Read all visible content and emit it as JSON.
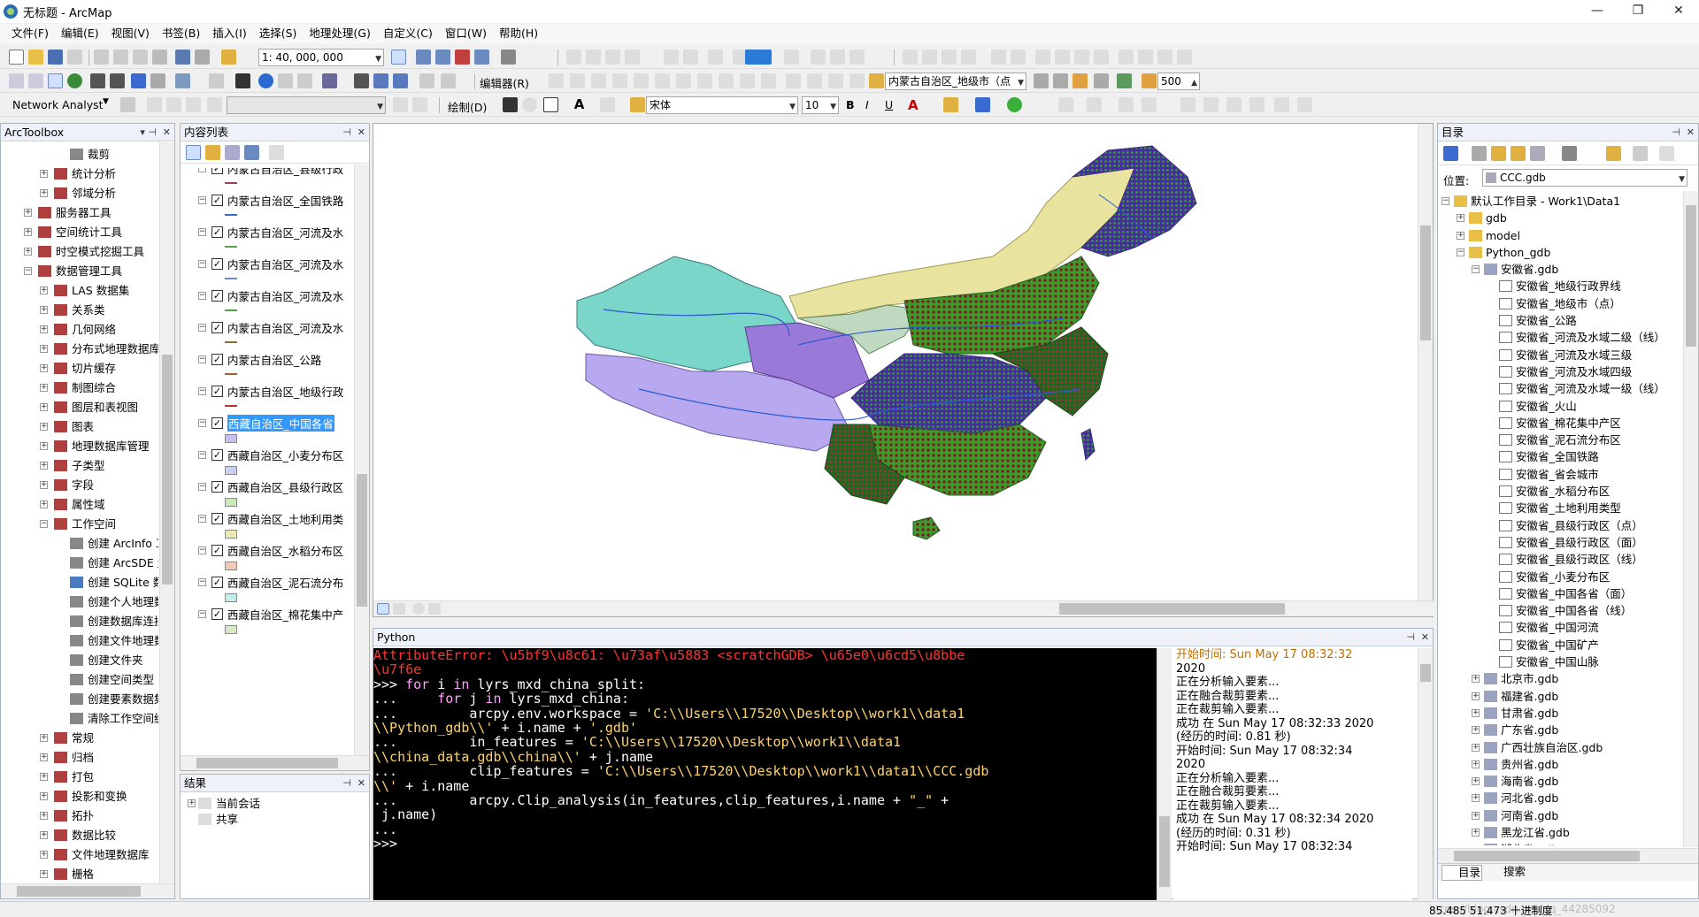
{
  "window": {
    "title": "无标题 - ArcMap",
    "btn_min": "—",
    "btn_max": "❐",
    "btn_close": "✕"
  },
  "menu": [
    "文件(F)",
    "编辑(E)",
    "视图(V)",
    "书签(B)",
    "插入(I)",
    "选择(S)",
    "地理处理(G)",
    "自定义(C)",
    "窗口(W)",
    "帮助(H)"
  ],
  "toolbar": {
    "scale": "1: 40, 000, 000",
    "editor_label": "编辑器(R)",
    "layer_combo": "内蒙古自治区_地级市（点",
    "distance": "500",
    "network_analyst": "Network Analyst",
    "draw_label": "绘制(D)",
    "font": "宋体",
    "font_size": "10",
    "bold": "B",
    "italic": "I",
    "underline": "U",
    "font_color": "A"
  },
  "arctoolbox": {
    "title": "ArcToolbox",
    "items": [
      {
        "label": "裁剪",
        "level": 2,
        "kind": "tool"
      },
      {
        "label": "统计分析",
        "level": 1,
        "kind": "box",
        "exp": "+"
      },
      {
        "label": "邻域分析",
        "level": 1,
        "kind": "box",
        "exp": "+"
      },
      {
        "label": "服务器工具",
        "level": 0,
        "kind": "box",
        "exp": "+"
      },
      {
        "label": "空间统计工具",
        "level": 0,
        "kind": "box",
        "exp": "+"
      },
      {
        "label": "时空模式挖掘工具",
        "level": 0,
        "kind": "box",
        "exp": "+"
      },
      {
        "label": "数据管理工具",
        "level": 0,
        "kind": "box",
        "exp": "−"
      },
      {
        "label": "LAS 数据集",
        "level": 1,
        "kind": "box",
        "exp": "+"
      },
      {
        "label": "关系类",
        "level": 1,
        "kind": "box",
        "exp": "+"
      },
      {
        "label": "几何网络",
        "level": 1,
        "kind": "box",
        "exp": "+"
      },
      {
        "label": "分布式地理数据库",
        "level": 1,
        "kind": "box",
        "exp": "+"
      },
      {
        "label": "切片缓存",
        "level": 1,
        "kind": "box",
        "exp": "+"
      },
      {
        "label": "制图综合",
        "level": 1,
        "kind": "box",
        "exp": "+"
      },
      {
        "label": "图层和表视图",
        "level": 1,
        "kind": "box",
        "exp": "+"
      },
      {
        "label": "图表",
        "level": 1,
        "kind": "box",
        "exp": "+"
      },
      {
        "label": "地理数据库管理",
        "level": 1,
        "kind": "box",
        "exp": "+"
      },
      {
        "label": "子类型",
        "level": 1,
        "kind": "box",
        "exp": "+"
      },
      {
        "label": "字段",
        "level": 1,
        "kind": "box",
        "exp": "+"
      },
      {
        "label": "属性域",
        "level": 1,
        "kind": "box",
        "exp": "+"
      },
      {
        "label": "工作空间",
        "level": 1,
        "kind": "box",
        "exp": "−"
      },
      {
        "label": "创建 ArcInfo 工",
        "level": 2,
        "kind": "tool"
      },
      {
        "label": "创建 ArcSDE 连",
        "level": 2,
        "kind": "tool"
      },
      {
        "label": "创建 SQLite 数据",
        "level": 2,
        "kind": "script"
      },
      {
        "label": "创建个人地理数据",
        "level": 2,
        "kind": "tool"
      },
      {
        "label": "创建数据库连接",
        "level": 2,
        "kind": "tool"
      },
      {
        "label": "创建文件地理数据",
        "level": 2,
        "kind": "tool"
      },
      {
        "label": "创建文件夹",
        "level": 2,
        "kind": "tool"
      },
      {
        "label": "创建空间类型",
        "level": 2,
        "kind": "tool"
      },
      {
        "label": "创建要素数据集",
        "level": 2,
        "kind": "tool"
      },
      {
        "label": "清除工作空间缓存",
        "level": 2,
        "kind": "tool"
      },
      {
        "label": "常规",
        "level": 1,
        "kind": "box",
        "exp": "+"
      },
      {
        "label": "归档",
        "level": 1,
        "kind": "box",
        "exp": "+"
      },
      {
        "label": "打包",
        "level": 1,
        "kind": "box",
        "exp": "+"
      },
      {
        "label": "投影和变换",
        "level": 1,
        "kind": "box",
        "exp": "+"
      },
      {
        "label": "拓扑",
        "level": 1,
        "kind": "box",
        "exp": "+"
      },
      {
        "label": "数据比较",
        "level": 1,
        "kind": "box",
        "exp": "+"
      },
      {
        "label": "文件地理数据库",
        "level": 1,
        "kind": "box",
        "exp": "+"
      },
      {
        "label": "栅格",
        "level": 1,
        "kind": "box",
        "exp": "+"
      }
    ]
  },
  "toc": {
    "title": "内容列表",
    "layers": [
      {
        "name": "内蒙古自治区_县级行政",
        "sym": "line",
        "color": "#a0405a"
      },
      {
        "name": "内蒙古自治区_全国铁路",
        "sym": "line",
        "color": "#3a6ad0"
      },
      {
        "name": "内蒙古自治区_河流及水",
        "sym": "line",
        "color": "#5aa050"
      },
      {
        "name": "内蒙古自治区_河流及水",
        "sym": "line",
        "color": "#6a8ac0"
      },
      {
        "name": "内蒙古自治区_河流及水",
        "sym": "line",
        "color": "#50a040"
      },
      {
        "name": "内蒙古自治区_河流及水",
        "sym": "line",
        "color": "#8a6a40"
      },
      {
        "name": "内蒙古自治区_公路",
        "sym": "line",
        "color": "#a06030"
      },
      {
        "name": "内蒙古自治区_地级行政",
        "sym": "line",
        "color": "#c03030"
      },
      {
        "name": "西藏自治区_中国各省",
        "sym": "fill",
        "color": "#c8c0ee",
        "selected": true
      },
      {
        "name": "西藏自治区_小麦分布区",
        "sym": "fill",
        "color": "#c8d0ee"
      },
      {
        "name": "西藏自治区_县级行政区",
        "sym": "fill",
        "color": "#cde8b8"
      },
      {
        "name": "西藏自治区_土地利用类",
        "sym": "fill",
        "color": "#ece8b4"
      },
      {
        "name": "西藏自治区_水稻分布区",
        "sym": "fill",
        "color": "#f0ccb8"
      },
      {
        "name": "西藏自治区_泥石流分布",
        "sym": "fill",
        "color": "#c4ecec"
      },
      {
        "name": "西藏自治区_棉花集中产",
        "sym": "fill",
        "color": "#d8e8c8"
      }
    ]
  },
  "results": {
    "title": "结果",
    "current": "当前会话",
    "shared": "共享"
  },
  "python": {
    "title": "Python",
    "lines": [
      [
        [
          "err",
          "AttributeError: \\u5bf9\\u8c61: \\u73af\\u5883 <scratchGDB> \\u65e0\\u6cd5\\u8bbe"
        ]
      ],
      [
        [
          "err",
          "\\u7f6e"
        ]
      ],
      [
        [
          "txt",
          ">>> "
        ],
        [
          "kw",
          "for"
        ],
        [
          "txt",
          " i "
        ],
        [
          "kw",
          "in"
        ],
        [
          "txt",
          " lyrs_mxd_china_split:"
        ]
      ],
      [
        [
          "txt",
          "...     "
        ],
        [
          "kw",
          "for"
        ],
        [
          "txt",
          " j "
        ],
        [
          "kw",
          "in"
        ],
        [
          "txt",
          " lyrs_mxd_china:"
        ]
      ],
      [
        [
          "txt",
          "...         arcpy.env.workspace = "
        ],
        [
          "str",
          "'C:\\\\Users\\\\17520\\\\Desktop\\\\work1\\\\data1"
        ]
      ],
      [
        [
          "str",
          "\\\\Python_gdb\\\\'"
        ],
        [
          "txt",
          " + i.name + "
        ],
        [
          "str",
          "'.gdb'"
        ]
      ],
      [
        [
          "txt",
          "...         in_features = "
        ],
        [
          "str",
          "'C:\\\\Users\\\\17520\\\\Desktop\\\\work1\\\\data1"
        ]
      ],
      [
        [
          "str",
          "\\\\china_data.gdb\\\\china\\\\'"
        ],
        [
          "txt",
          " + j.name"
        ]
      ],
      [
        [
          "txt",
          "...         clip_features = "
        ],
        [
          "str",
          "'C:\\\\Users\\\\17520\\\\Desktop\\\\work1\\\\data1\\\\CCC.gdb"
        ]
      ],
      [
        [
          "str",
          "\\\\'"
        ],
        [
          "txt",
          " + i.name"
        ]
      ],
      [
        [
          "txt",
          "...         arcpy.Clip_analysis(in_features,clip_features,i.name + "
        ],
        [
          "str",
          "\"_\""
        ],
        [
          "txt",
          " +"
        ]
      ],
      [
        [
          "txt",
          " j.name)"
        ]
      ],
      [
        [
          "txt",
          "..."
        ]
      ],
      [
        [
          "txt",
          ">>> "
        ]
      ]
    ],
    "output": [
      [
        "hl",
        "开始时间: Sun May 17 08:32:32"
      ],
      [
        "t",
        "2020"
      ],
      [
        "t",
        "正在分析输入要素..."
      ],
      [
        "t",
        "正在融合裁剪要素..."
      ],
      [
        "t",
        "正在裁剪输入要素..."
      ],
      [
        "t",
        "成功 在 Sun May 17 08:32:33 2020"
      ],
      [
        "t",
        "(经历的时间: 0.81 秒)"
      ],
      [
        "t",
        "开始时间: Sun May 17 08:32:34"
      ],
      [
        "t",
        "2020"
      ],
      [
        "t",
        "正在分析输入要素..."
      ],
      [
        "t",
        "正在融合裁剪要素..."
      ],
      [
        "t",
        "正在裁剪输入要素..."
      ],
      [
        "t",
        "成功 在 Sun May 17 08:32:34 2020"
      ],
      [
        "t",
        "(经历的时间: 0.31 秒)"
      ],
      [
        "t",
        "开始时间: Sun May 17 08:32:34"
      ]
    ]
  },
  "catalog": {
    "title": "目录",
    "location_label": "位置:",
    "location_value": "CCC.gdb",
    "items": [
      {
        "label": "默认工作目录 - Work1\\Data1",
        "level": 0,
        "kind": "folder",
        "exp": "−"
      },
      {
        "label": "gdb",
        "level": 1,
        "kind": "folder",
        "exp": "+"
      },
      {
        "label": "model",
        "level": 1,
        "kind": "folder",
        "exp": "+"
      },
      {
        "label": "Python_gdb",
        "level": 1,
        "kind": "folder",
        "exp": "−"
      },
      {
        "label": "安徽省.gdb",
        "level": 2,
        "kind": "gdb",
        "exp": "−"
      },
      {
        "label": "安徽省_地级行政界线",
        "level": 3,
        "kind": "fc"
      },
      {
        "label": "安徽省_地级市（点）",
        "level": 3,
        "kind": "fc"
      },
      {
        "label": "安徽省_公路",
        "level": 3,
        "kind": "fc"
      },
      {
        "label": "安徽省_河流及水域二级（线）",
        "level": 3,
        "kind": "fc"
      },
      {
        "label": "安徽省_河流及水域三级",
        "level": 3,
        "kind": "fc"
      },
      {
        "label": "安徽省_河流及水域四级",
        "level": 3,
        "kind": "fc"
      },
      {
        "label": "安徽省_河流及水域一级（线）",
        "level": 3,
        "kind": "fc"
      },
      {
        "label": "安徽省_火山",
        "level": 3,
        "kind": "fc"
      },
      {
        "label": "安徽省_棉花集中产区",
        "level": 3,
        "kind": "fc"
      },
      {
        "label": "安徽省_泥石流分布区",
        "level": 3,
        "kind": "fc"
      },
      {
        "label": "安徽省_全国铁路",
        "level": 3,
        "kind": "fc"
      },
      {
        "label": "安徽省_省会城市",
        "level": 3,
        "kind": "fc"
      },
      {
        "label": "安徽省_水稻分布区",
        "level": 3,
        "kind": "fc"
      },
      {
        "label": "安徽省_土地利用类型",
        "level": 3,
        "kind": "fc"
      },
      {
        "label": "安徽省_县级行政区（点）",
        "level": 3,
        "kind": "fc"
      },
      {
        "label": "安徽省_县级行政区（面）",
        "level": 3,
        "kind": "fc"
      },
      {
        "label": "安徽省_县级行政区（线）",
        "level": 3,
        "kind": "fc"
      },
      {
        "label": "安徽省_小麦分布区",
        "level": 3,
        "kind": "fc"
      },
      {
        "label": "安徽省_中国各省（面）",
        "level": 3,
        "kind": "fc"
      },
      {
        "label": "安徽省_中国各省（线）",
        "level": 3,
        "kind": "fc"
      },
      {
        "label": "安徽省_中国河流",
        "level": 3,
        "kind": "fc"
      },
      {
        "label": "安徽省_中国矿产",
        "level": 3,
        "kind": "fc"
      },
      {
        "label": "安徽省_中国山脉",
        "level": 3,
        "kind": "fc"
      },
      {
        "label": "北京市.gdb",
        "level": 2,
        "kind": "gdb",
        "exp": "+"
      },
      {
        "label": "福建省.gdb",
        "level": 2,
        "kind": "gdb",
        "exp": "+"
      },
      {
        "label": "甘肃省.gdb",
        "level": 2,
        "kind": "gdb",
        "exp": "+"
      },
      {
        "label": "广东省.gdb",
        "level": 2,
        "kind": "gdb",
        "exp": "+"
      },
      {
        "label": "广西壮族自治区.gdb",
        "level": 2,
        "kind": "gdb",
        "exp": "+"
      },
      {
        "label": "贵州省.gdb",
        "level": 2,
        "kind": "gdb",
        "exp": "+"
      },
      {
        "label": "海南省.gdb",
        "level": 2,
        "kind": "gdb",
        "exp": "+"
      },
      {
        "label": "河北省.gdb",
        "level": 2,
        "kind": "gdb",
        "exp": "+"
      },
      {
        "label": "河南省.gdb",
        "level": 2,
        "kind": "gdb",
        "exp": "+"
      },
      {
        "label": "黑龙江省.gdb",
        "level": 2,
        "kind": "gdb",
        "exp": "+"
      },
      {
        "label": "湖北省.gdb",
        "level": 2,
        "kind": "gdb",
        "exp": "+"
      }
    ],
    "tab_catalog": "目录",
    "tab_search": "搜索"
  },
  "status": {
    "coords": "85.485  51.473 十进制度",
    "watermark": "https://blog.csdn.net/qq_44285092"
  }
}
